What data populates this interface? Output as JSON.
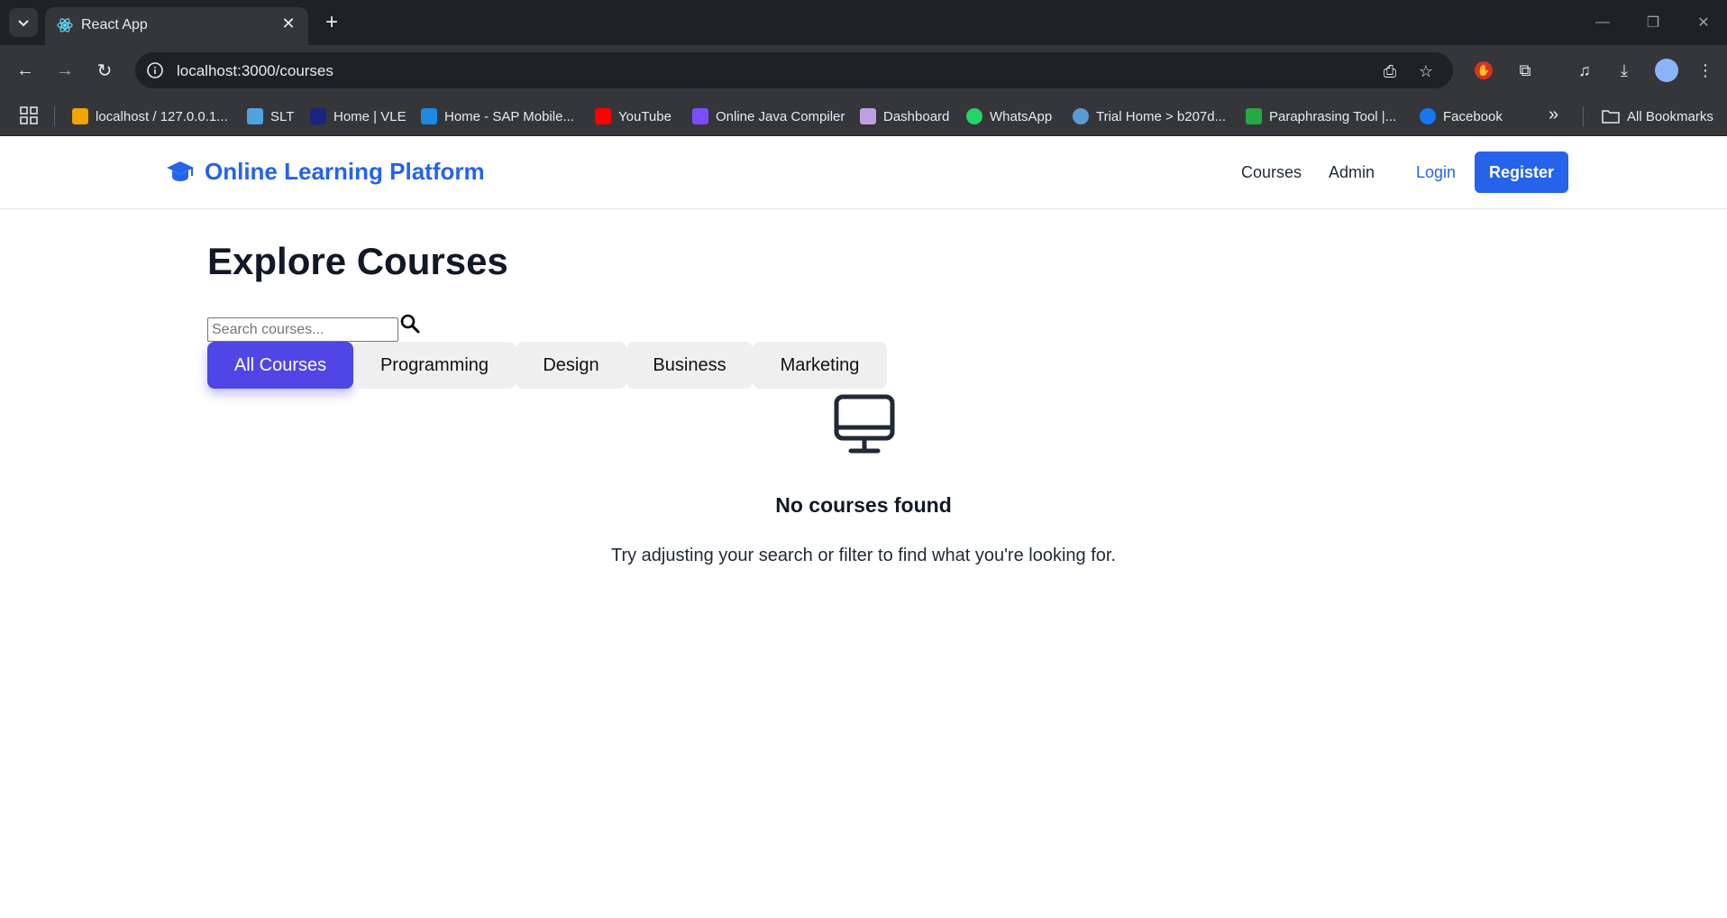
{
  "browser": {
    "tab_title": "React App",
    "url": "localhost:3000/courses",
    "bookmarks": [
      {
        "label": "localhost / 127.0.0.1...",
        "icon": "phpmyadmin-icon",
        "color": "#f0a500"
      },
      {
        "label": "SLT",
        "icon": "slt-icon",
        "color": "#4fa3e0"
      },
      {
        "label": "Home | VLE",
        "icon": "vle-icon",
        "color": "#1a237e"
      },
      {
        "label": "Home - SAP Mobile...",
        "icon": "sap-icon",
        "color": "#1e88e5"
      },
      {
        "label": "YouTube",
        "icon": "youtube-icon",
        "color": "#ff0000"
      },
      {
        "label": "Online Java Compiler",
        "icon": "compiler-icon",
        "color": "#7c4dff"
      },
      {
        "label": "Dashboard",
        "icon": "dashboard-icon",
        "color": "#c0a0e0"
      },
      {
        "label": "WhatsApp",
        "icon": "whatsapp-icon",
        "color": "#25d366"
      },
      {
        "label": "Trial Home > b207d...",
        "icon": "cloud-icon",
        "color": "#5b9bd5"
      },
      {
        "label": "Paraphrasing Tool |...",
        "icon": "paraphrase-icon",
        "color": "#27a844"
      },
      {
        "label": "Facebook",
        "icon": "facebook-icon",
        "color": "#1877f2"
      }
    ],
    "all_bookmarks": "All Bookmarks"
  },
  "app": {
    "brand": "Online Learning Platform",
    "nav": {
      "courses": "Courses",
      "admin": "Admin",
      "login": "Login",
      "register": "Register"
    }
  },
  "main": {
    "title": "Explore Courses",
    "search_placeholder": "Search courses...",
    "filters": [
      "All Courses",
      "Programming",
      "Design",
      "Business",
      "Marketing"
    ],
    "active_filter": "All Courses",
    "empty_title": "No courses found",
    "empty_text": "Try adjusting your search or filter to find what you're looking for."
  },
  "colors": {
    "brand": "#2563eb",
    "active_filter": "#4f46e5"
  }
}
